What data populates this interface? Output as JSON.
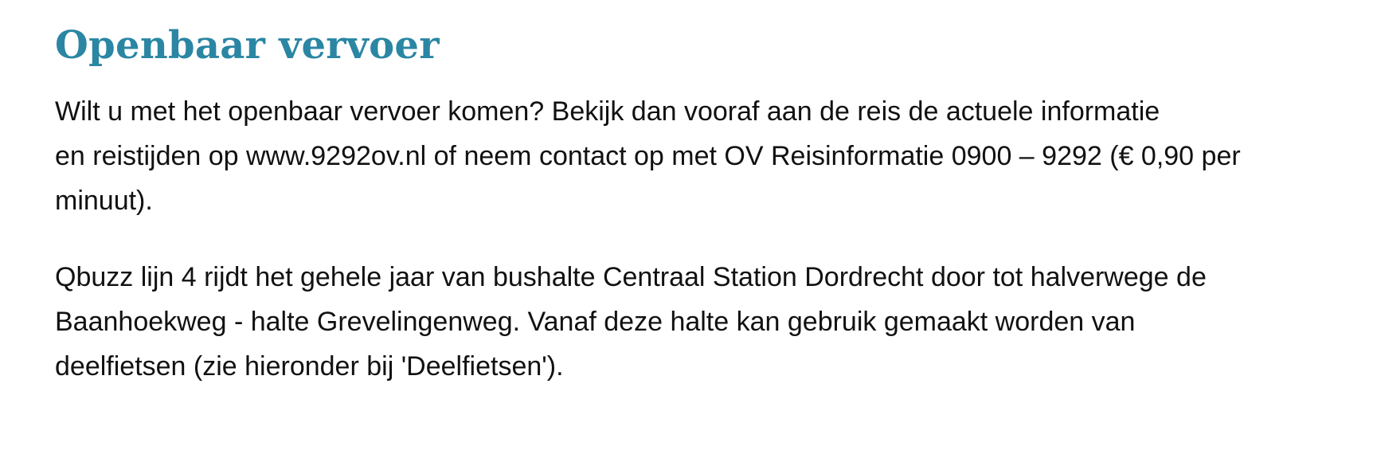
{
  "section": {
    "title": "Openbaar vervoer",
    "paragraph1": {
      "lines": [
        "Wilt u met het openbaar vervoer komen? Bekijk dan vooraf aan de reis de actuele informatie",
        "en reistijden op www.9292ov.nl of neem contact op met OV Reisinformatie 0900 – 9292 (€ 0,90 per",
        "minuut)."
      ]
    },
    "paragraph2": {
      "lines": [
        "Qbuzz lijn 4 rijdt het gehele jaar van bushalte Centraal Station Dordrecht door tot halverwege de",
        "Baanhoekweg - halte Grevelingenweg. Vanaf deze halte kan gebruik gemaakt worden van",
        "deelfietsen (zie hieronder bij 'Deelfietsen')."
      ]
    }
  }
}
